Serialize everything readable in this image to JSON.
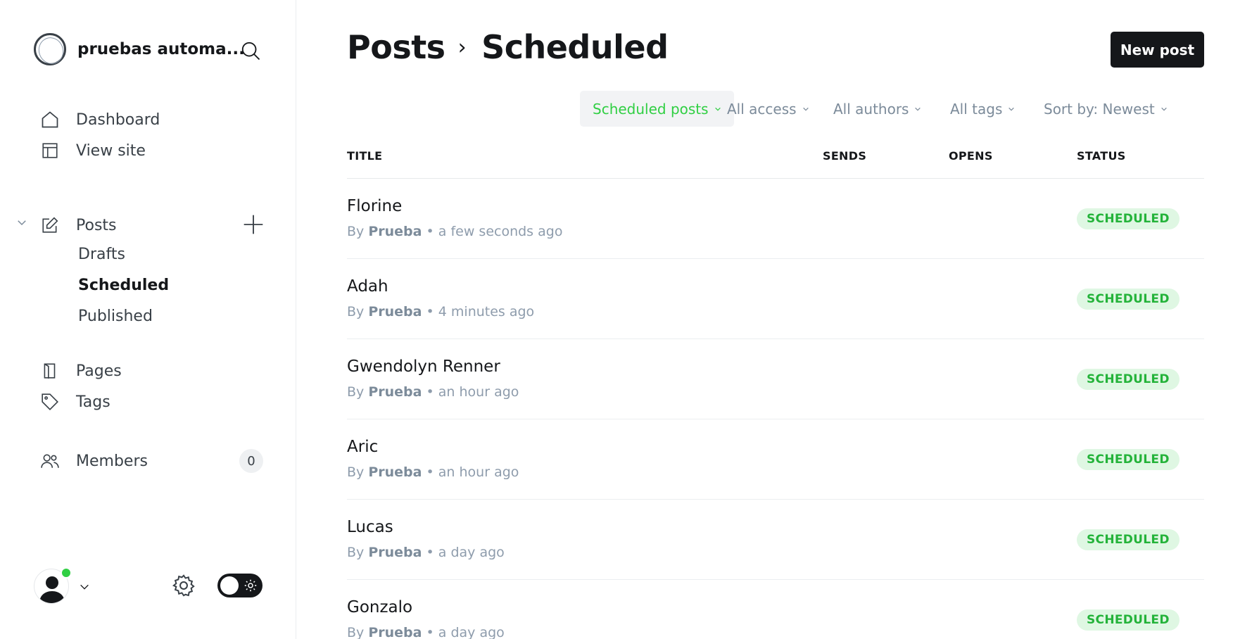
{
  "sidebar": {
    "site_name": "pruebas automa...",
    "nav": {
      "dashboard": "Dashboard",
      "view_site": "View site",
      "posts": "Posts",
      "drafts": "Drafts",
      "scheduled": "Scheduled",
      "published": "Published",
      "pages": "Pages",
      "tags": "Tags",
      "members": "Members",
      "members_count": "0"
    }
  },
  "header": {
    "breadcrumb_root": "Posts",
    "breadcrumb_separator": "›",
    "breadcrumb_current": "Scheduled",
    "new_post_label": "New post"
  },
  "filters": {
    "type": "Scheduled posts",
    "access": "All access",
    "authors": "All authors",
    "tags": "All tags",
    "sort": "Sort by: Newest"
  },
  "table": {
    "columns": [
      "TITLE",
      "SENDS",
      "OPENS",
      "STATUS"
    ],
    "rows": [
      {
        "title": "Florine",
        "by": "By",
        "author": "Prueba",
        "sep": "•",
        "time": "a few seconds ago",
        "status": "SCHEDULED"
      },
      {
        "title": "Adah",
        "by": "By",
        "author": "Prueba",
        "sep": "•",
        "time": "4 minutes ago",
        "status": "SCHEDULED"
      },
      {
        "title": "Gwendolyn Renner",
        "by": "By",
        "author": "Prueba",
        "sep": "•",
        "time": "an hour ago",
        "status": "SCHEDULED"
      },
      {
        "title": "Aric",
        "by": "By",
        "author": "Prueba",
        "sep": "•",
        "time": "an hour ago",
        "status": "SCHEDULED"
      },
      {
        "title": "Lucas",
        "by": "By",
        "author": "Prueba",
        "sep": "•",
        "time": "a day ago",
        "status": "SCHEDULED"
      },
      {
        "title": "Gonzalo",
        "by": "By",
        "author": "Prueba",
        "sep": "•",
        "time": "a day ago",
        "status": "SCHEDULED"
      }
    ]
  },
  "colors": {
    "accent_green": "#30cf43",
    "badge_bg": "#dff7e3",
    "dark": "#15171a",
    "muted": "#8e9cac"
  }
}
